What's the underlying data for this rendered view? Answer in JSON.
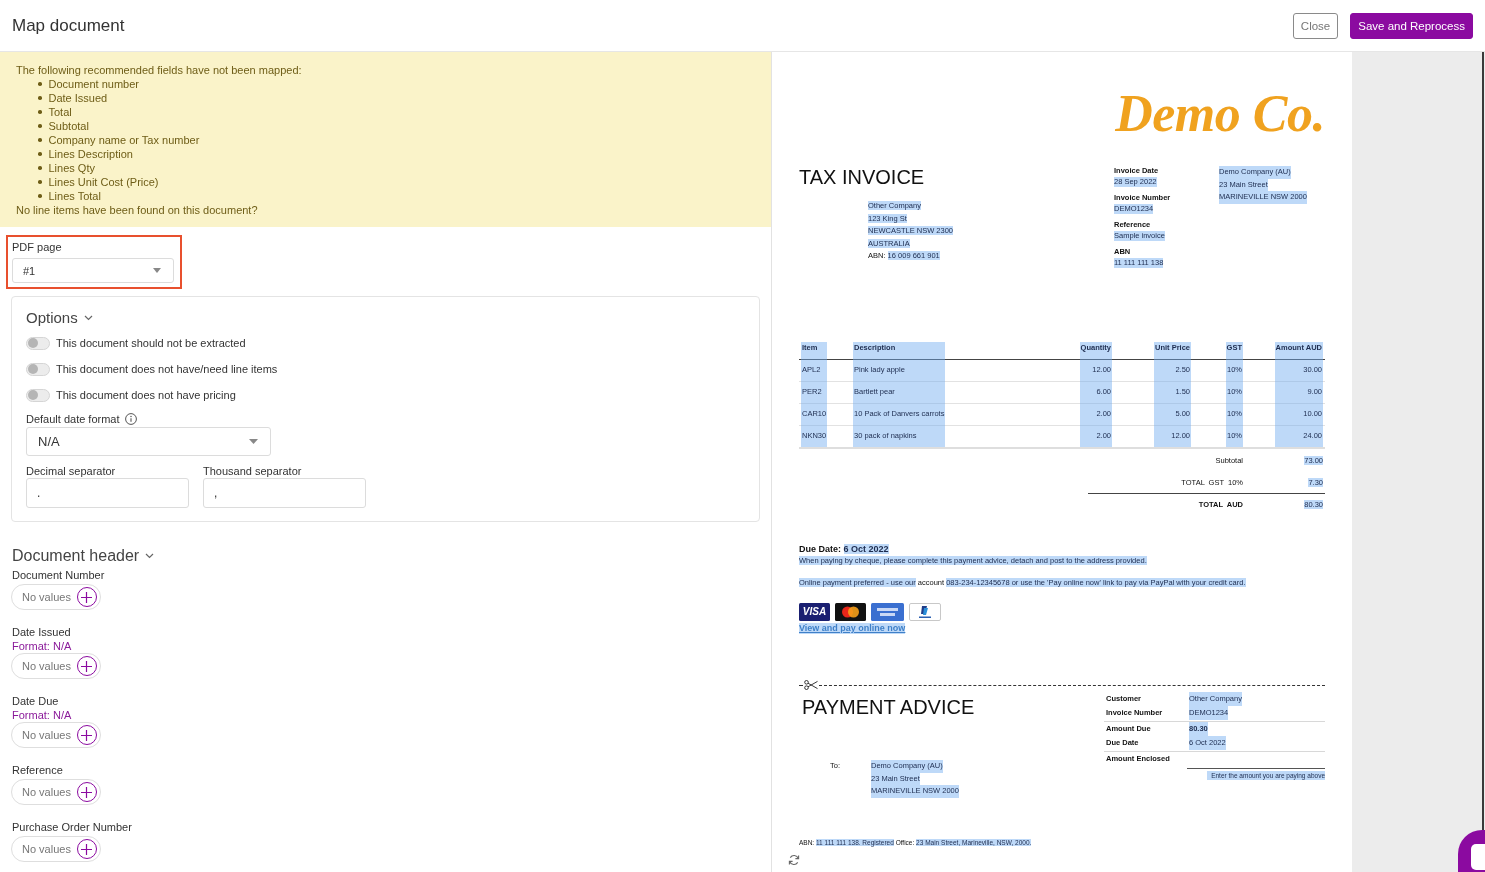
{
  "header": {
    "title": "Map document",
    "buttons": [
      {
        "label": "Close",
        "kind": "close"
      },
      {
        "label": "Save and Reprocess",
        "kind": "save"
      }
    ]
  },
  "warning": {
    "intro": "The following recommended fields have not been mapped:",
    "items": [
      "Document number",
      "Date Issued",
      "Total",
      "Subtotal",
      "Company name or Tax number",
      "Lines Description",
      "Lines Qty",
      "Lines Unit Cost (Price)",
      "Lines Total"
    ],
    "note": "No line items have been found on this document?"
  },
  "pdf_page": {
    "label": "PDF page",
    "value": "#1",
    "annotated": true
  },
  "options": {
    "title": "Options",
    "expanded": true,
    "toggles": [
      {
        "label": "This document should not be extracted",
        "on": false
      },
      {
        "label": "This document does not have/need line items",
        "on": false
      },
      {
        "label": "This document does not have pricing",
        "on": false
      }
    ],
    "date_format": {
      "label": "Default date format",
      "value": "N/A"
    },
    "separators": [
      {
        "label": "Decimal separator",
        "value": "."
      },
      {
        "label": "Thousand separator",
        "value": ","
      }
    ]
  },
  "document_header": {
    "title": "Document header",
    "expanded": true,
    "fields": [
      {
        "label": "Document Number",
        "value": "No values"
      },
      {
        "label": "Date Issued",
        "format": "Format: N/A",
        "value": "No values"
      },
      {
        "label": "Date Due",
        "format": "Format: N/A",
        "value": "No values"
      },
      {
        "label": "Reference",
        "value": "No values"
      },
      {
        "label": "Purchase Order Number",
        "value": "No values"
      }
    ]
  },
  "document": {
    "logo": "Demo Co.",
    "title": "TAX INVOICE",
    "bill_to": [
      {
        "text": "Other Company",
        "highlighted": true
      },
      {
        "text": "123 King St",
        "highlighted": true
      },
      {
        "text": "NEWCASTLE NSW 2300",
        "highlighted": true
      },
      {
        "text": "AUSTRALIA",
        "highlighted": true
      },
      {
        "label": "ABN:",
        "text": "16 009 661 901",
        "highlighted": true
      }
    ],
    "details": [
      {
        "label": "Invoice Date",
        "value": "28 Sep 2022",
        "highlighted": true
      },
      {
        "label": "Invoice Number",
        "value": "DEMO1234",
        "highlighted": true
      },
      {
        "label": "Reference",
        "value": "Sample invoice",
        "highlighted": true
      },
      {
        "label": "ABN",
        "value": "11 111 111 138",
        "highlighted": true
      }
    ],
    "from": [
      {
        "text": "Demo Company (AU)",
        "highlighted": true
      },
      {
        "text": "23 Main Street",
        "highlighted": true
      },
      {
        "text": "MARINEVILLE NSW 2000",
        "highlighted": true
      }
    ],
    "table": {
      "columns": [
        {
          "header": "Item",
          "kind": "text",
          "highlighted": true
        },
        {
          "header": "Description",
          "kind": "text",
          "highlighted": true
        },
        {
          "header": "Quantity",
          "kind": "number",
          "highlighted": true
        },
        {
          "header": "Unit Price",
          "kind": "number",
          "highlighted": true
        },
        {
          "header": "GST",
          "kind": "number",
          "highlighted": true
        },
        {
          "header": "Amount AUD",
          "kind": "number",
          "highlighted": true
        }
      ],
      "rows": [
        [
          "APL2",
          "Pink lady apple",
          "12.00",
          "2.50",
          "10%",
          "30.00"
        ],
        [
          "PER2",
          "Bartlett pear",
          "6.00",
          "1.50",
          "10%",
          "9.00"
        ],
        [
          "CAR10",
          "10 Pack of Danvers carrots",
          "2.00",
          "5.00",
          "10%",
          "10.00"
        ],
        [
          "NKN30",
          "30 pack of napkins",
          "2.00",
          "12.00",
          "10%",
          "24.00"
        ]
      ]
    },
    "totals": [
      {
        "kind": "sub",
        "label": "Subtotal",
        "value": "73.00",
        "highlighted": true
      },
      {
        "kind": "sub",
        "label": "TOTAL GST 10%",
        "value": "7.30",
        "highlighted": true
      },
      {
        "kind": "grand",
        "label": "TOTAL AUD",
        "value": "80.30",
        "highlighted": true
      }
    ],
    "due_date": {
      "label": "Due Date:",
      "value": "6 Oct 2022",
      "highlighted": true
    },
    "instructions": [
      {
        "segments": [
          {
            "text": "When paying by cheque, please complete this payment advice, detach and post to the address provided.",
            "highlighted": true
          }
        ]
      },
      {
        "segments": [
          {
            "text": "Online payment preferred - use our",
            "highlighted": true
          },
          {
            "text": "account",
            "highlighted": false
          },
          {
            "text": "083-234-12345678 or use the 'Pay online now' link to pay via PayPal with your credit card.",
            "highlighted": true
          }
        ]
      }
    ],
    "payment_cards": [
      {
        "kind": "visa",
        "label": "VISA"
      },
      {
        "kind": "mastercard"
      },
      {
        "kind": "amex"
      },
      {
        "kind": "paypal"
      }
    ],
    "pay_link": {
      "text": "View and pay online now",
      "highlighted": true
    },
    "payment_advice": {
      "title": "PAYMENT ADVICE",
      "to_label": "To:",
      "to": [
        {
          "text": "Demo Company (AU)",
          "highlighted": true
        },
        {
          "text": "23 Main Street",
          "highlighted": true
        },
        {
          "text": "MARINEVILLE NSW 2000",
          "highlighted": true
        }
      ],
      "groups": [
        [
          {
            "kind": "field",
            "label": "Customer",
            "value": "Other Company",
            "highlighted": true
          },
          {
            "kind": "field",
            "label": "Invoice Number",
            "value": "DEMO1234",
            "highlighted": true
          }
        ],
        [
          {
            "kind": "strong",
            "label": "Amount Due",
            "value": "80.30",
            "highlighted": true
          },
          {
            "kind": "field",
            "label": "Due Date",
            "value": "6 Oct 2022",
            "highlighted": true
          }
        ],
        [
          {
            "kind": "blank",
            "label": "Amount Enclosed",
            "hint": "Enter the amount you are paying above",
            "highlighted": true
          }
        ]
      ]
    },
    "footer": {
      "segments": [
        {
          "text": "ABN:",
          "highlighted": false
        },
        {
          "text": "11 111 111 138. Registered",
          "highlighted": true
        },
        {
          "text": "Office:",
          "highlighted": false
        },
        {
          "text": "23 Main Street, Marineville, NSW, 2000.",
          "highlighted": true
        }
      ]
    }
  }
}
